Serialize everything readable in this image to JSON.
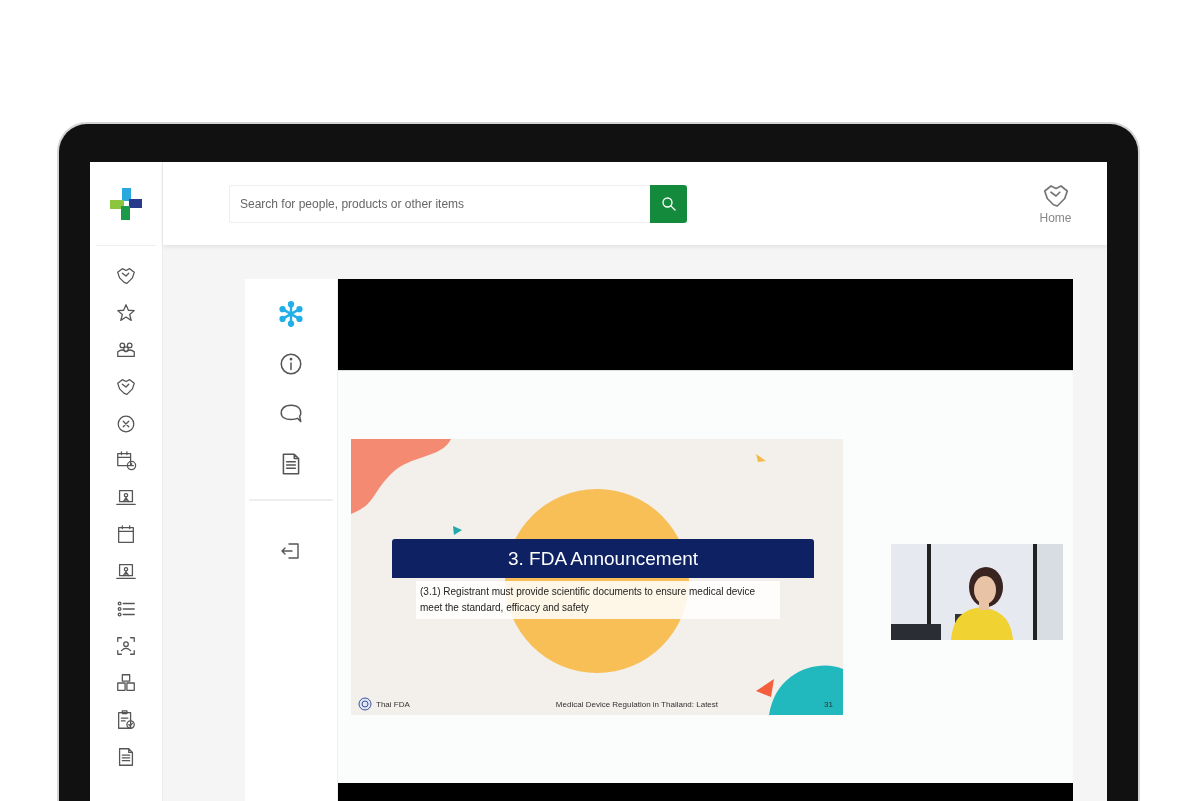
{
  "search": {
    "placeholder": "Search for people, products or other items"
  },
  "header_nav": [
    {
      "label": "Home"
    }
  ],
  "tool_panel": {
    "tools": [
      {
        "selected": true
      },
      {
        "selected": false
      },
      {
        "selected": false
      },
      {
        "selected": false
      }
    ]
  },
  "slide": {
    "title": "3. FDA Announcement",
    "body": "(3.1) Registrant must provide scientific documents to ensure medical device meet the standard, efficacy and safety",
    "org": "Thai FDA",
    "footer": "Medical Device Regulation in Thailand: Latest",
    "page": "31"
  }
}
